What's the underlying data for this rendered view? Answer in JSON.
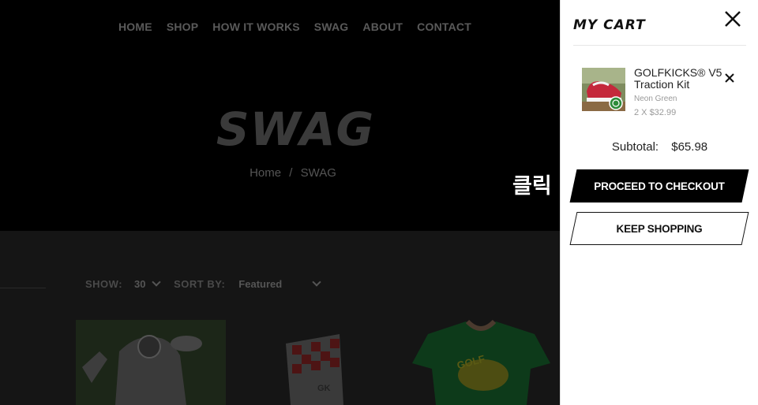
{
  "nav": {
    "items": [
      "HOME",
      "SHOP",
      "HOW IT WORKS",
      "SWAG",
      "ABOUT",
      "CONTACT"
    ]
  },
  "hero": {
    "title": "SWAG",
    "breadcrumb": {
      "home": "Home",
      "separator": "/",
      "current": "SWAG"
    }
  },
  "annotation": {
    "text": "클릭"
  },
  "toolbar": {
    "show_label": "SHOW:",
    "show_value": "30",
    "sort_label": "SORT BY:",
    "sort_value": "Featured"
  },
  "cart": {
    "title": "MY CART",
    "close_icon": "close-icon",
    "items": [
      {
        "name": "GOLFKICKS® V5 Traction Kit",
        "variant": "Neon Green",
        "qty_price": "2 X $32.99",
        "remove_icon": "close-icon"
      }
    ],
    "subtotal_label": "Subtotal:",
    "subtotal_value": "$65.98",
    "checkout_label": "PROCEED TO CHECKOUT",
    "keep_shopping_label": "KEEP SHOPPING"
  },
  "colors": {
    "overlay_dark": "#000000",
    "drawer_bg": "#ffffff",
    "checkout_bg": "#000000",
    "badge_green": "#2e8b3a"
  }
}
